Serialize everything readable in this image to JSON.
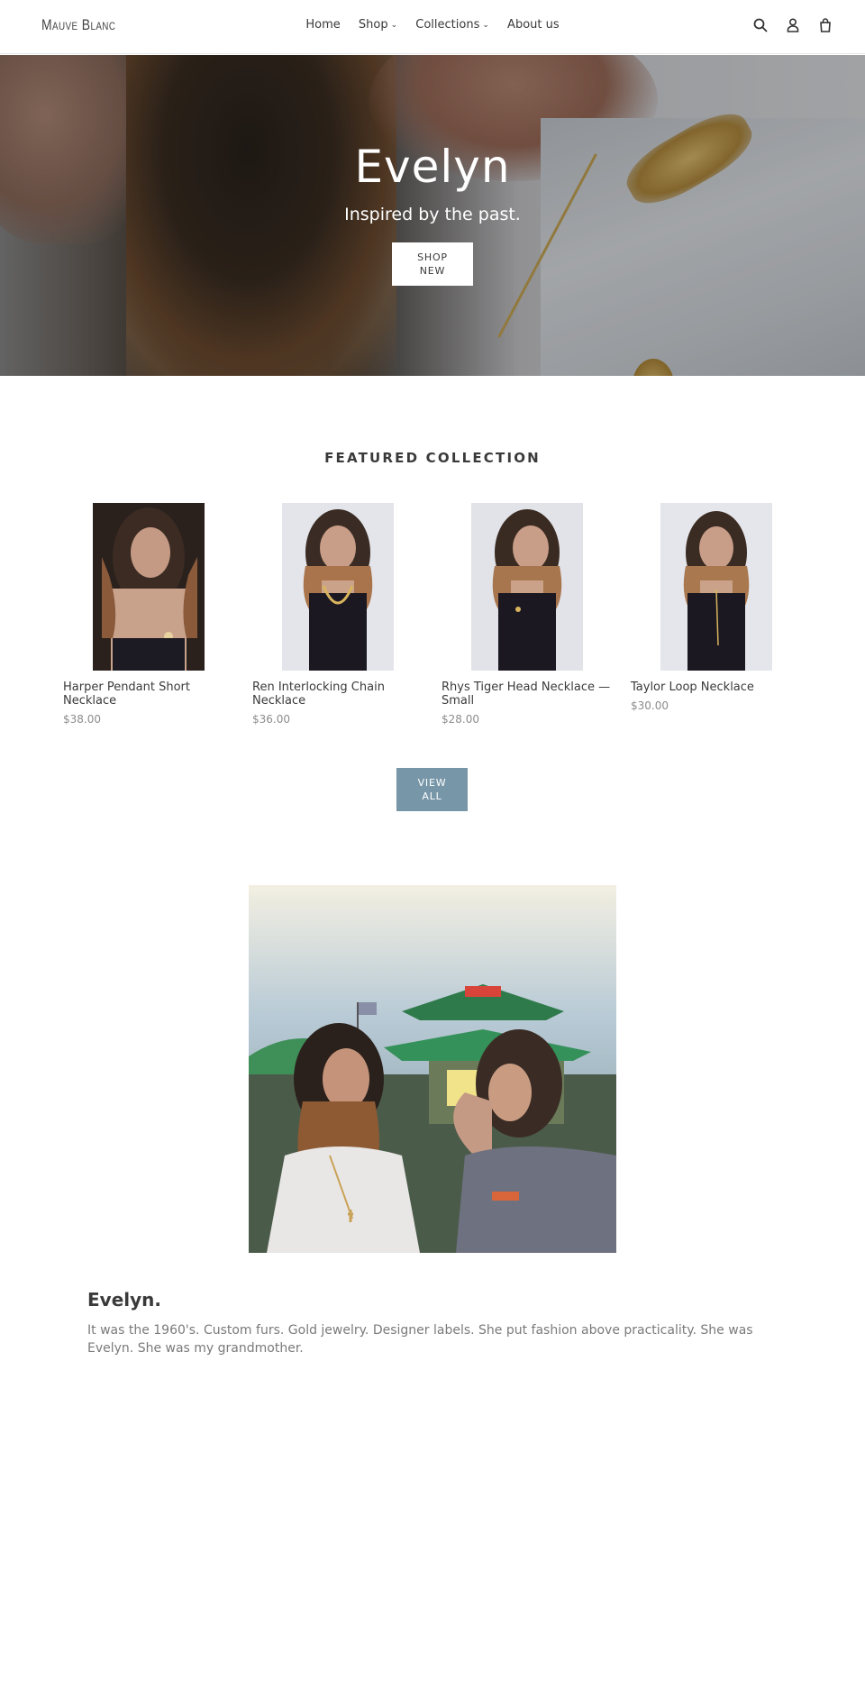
{
  "header": {
    "logo": "Mauve Blanc",
    "nav": [
      {
        "label": "Home",
        "dropdown": false
      },
      {
        "label": "Shop",
        "dropdown": true
      },
      {
        "label": "Collections",
        "dropdown": true
      },
      {
        "label": "About us",
        "dropdown": false
      }
    ],
    "icons": [
      "search-icon",
      "account-icon",
      "cart-icon"
    ]
  },
  "hero": {
    "title": "Evelyn",
    "subtitle": "Inspired by the past.",
    "button_line1": "SHOP",
    "button_line2": "NEW"
  },
  "featured": {
    "title": "FEATURED COLLECTION",
    "products": [
      {
        "name": "Harper Pendant Short Necklace",
        "price": "$38.00"
      },
      {
        "name": "Ren Interlocking Chain Necklace",
        "price": "$36.00"
      },
      {
        "name": "Rhys Tiger Head Necklace — Small",
        "price": "$28.00"
      },
      {
        "name": "Taylor Loop Necklace",
        "price": "$30.00"
      }
    ],
    "view_all_line1": "VIEW",
    "view_all_line2": "ALL"
  },
  "story": {
    "heading": "Evelyn.",
    "text": "It was the 1960's. Custom furs. Gold jewelry. Designer labels. She put fashion above practicality. She was Evelyn. She was my grandmother."
  },
  "colors": {
    "accent_button": "#7796a8",
    "price": "#8c8c8c",
    "text": "#3a3a3a"
  }
}
